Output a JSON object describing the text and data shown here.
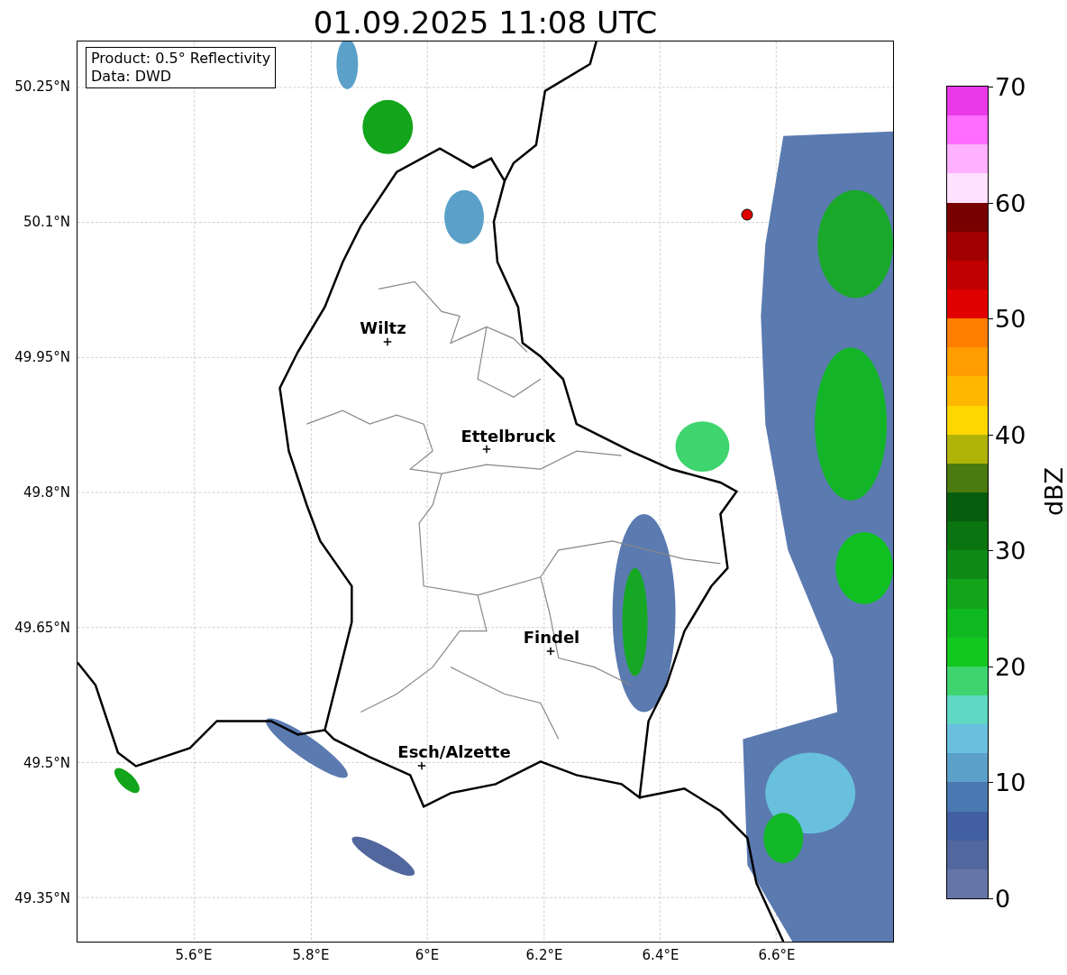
{
  "title": "01.09.2025 11:08 UTC",
  "info_box": [
    "Product: 0.5° Reflectivity",
    "Data: DWD"
  ],
  "map": {
    "yticks": [
      "50.25°N",
      "50.1°N",
      "49.95°N",
      "49.8°N",
      "49.65°N",
      "49.5°N",
      "49.35°N"
    ],
    "xticks": [
      "5.6°E",
      "5.8°E",
      "6°E",
      "6.2°E",
      "6.4°E",
      "6.6°E"
    ],
    "cities": [
      {
        "name": "Wiltz"
      },
      {
        "name": "Ettelbruck"
      },
      {
        "name": "Findel"
      },
      {
        "name": "Esch/Alzette"
      }
    ]
  },
  "colorbar": {
    "label": "dBZ",
    "ticks": [
      "70",
      "60",
      "50",
      "40",
      "30",
      "20",
      "10",
      "0"
    ],
    "bands": [
      {
        "color": "#e838e8"
      },
      {
        "color": "#ff6cff"
      },
      {
        "color": "#ffb0ff"
      },
      {
        "color": "#ffe0ff"
      },
      {
        "color": "#780000"
      },
      {
        "color": "#a00000"
      },
      {
        "color": "#c00000"
      },
      {
        "color": "#e00000"
      },
      {
        "color": "#ff7e00"
      },
      {
        "color": "#ff9c00"
      },
      {
        "color": "#ffb800"
      },
      {
        "color": "#ffd700"
      },
      {
        "color": "#b0b408"
      },
      {
        "color": "#4a7a10"
      },
      {
        "color": "#075c0e"
      },
      {
        "color": "#0a7410"
      },
      {
        "color": "#0e8a16"
      },
      {
        "color": "#12a41a"
      },
      {
        "color": "#10b820"
      },
      {
        "color": "#12c81f"
      },
      {
        "color": "#3ed46e"
      },
      {
        "color": "#5fd8c4"
      },
      {
        "color": "#68c0dc"
      },
      {
        "color": "#5aa0c8"
      },
      {
        "color": "#4a78b0"
      },
      {
        "color": "#425fa3"
      },
      {
        "color": "#52679e"
      },
      {
        "color": "#6575a8"
      }
    ]
  }
}
